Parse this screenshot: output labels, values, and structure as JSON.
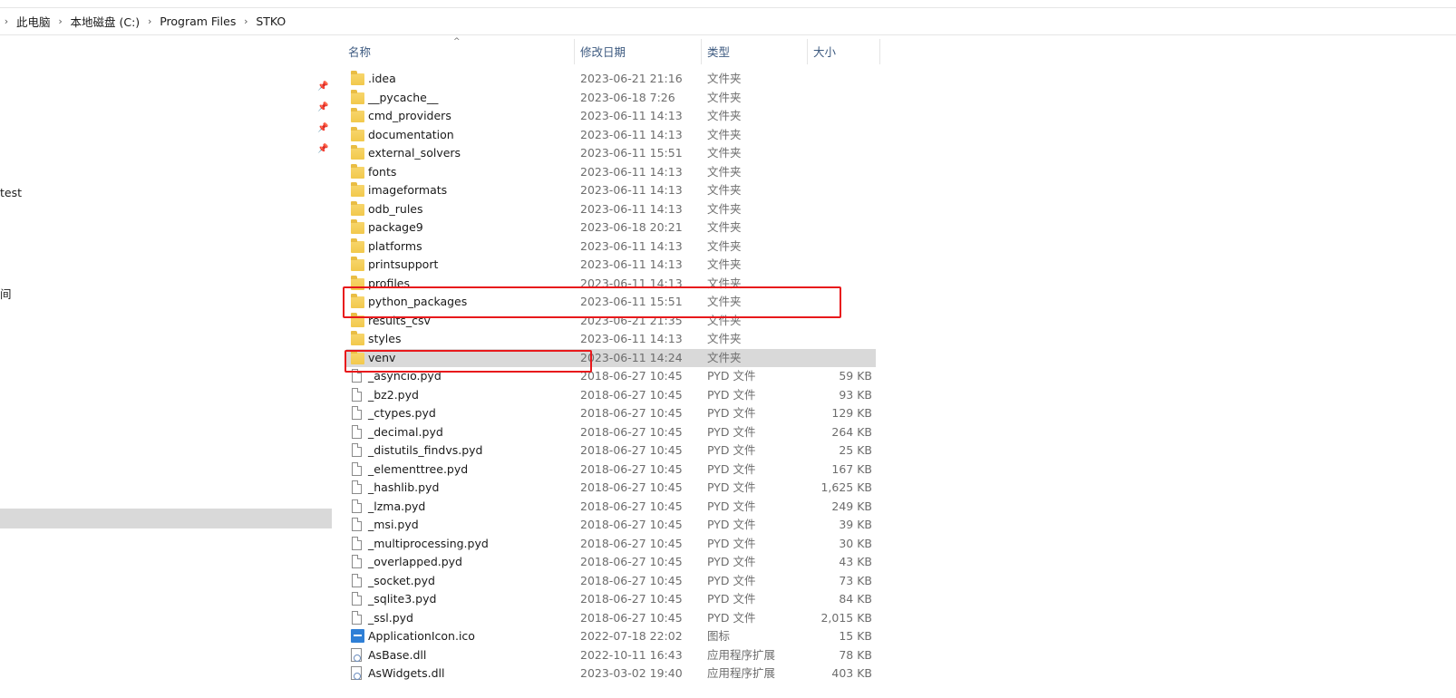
{
  "breadcrumb": [
    "此电脑",
    "本地磁盘 (C:)",
    "Program Files",
    "STKO"
  ],
  "nav": {
    "items": [
      "test",
      "间"
    ]
  },
  "columns": {
    "name": "名称",
    "date": "修改日期",
    "type": "类型",
    "size": "大小"
  },
  "files": [
    {
      "name": ".idea",
      "date": "2023-06-21 21:16",
      "type": "文件夹",
      "size": "",
      "icon": "folder-icon"
    },
    {
      "name": "__pycache__",
      "date": "2023-06-18 7:26",
      "type": "文件夹",
      "size": "",
      "icon": "folder-icon"
    },
    {
      "name": "cmd_providers",
      "date": "2023-06-11 14:13",
      "type": "文件夹",
      "size": "",
      "icon": "folder-icon"
    },
    {
      "name": "documentation",
      "date": "2023-06-11 14:13",
      "type": "文件夹",
      "size": "",
      "icon": "folder-icon"
    },
    {
      "name": "external_solvers",
      "date": "2023-06-11 15:51",
      "type": "文件夹",
      "size": "",
      "icon": "folder-icon"
    },
    {
      "name": "fonts",
      "date": "2023-06-11 14:13",
      "type": "文件夹",
      "size": "",
      "icon": "folder-icon"
    },
    {
      "name": "imageformats",
      "date": "2023-06-11 14:13",
      "type": "文件夹",
      "size": "",
      "icon": "folder-icon"
    },
    {
      "name": "odb_rules",
      "date": "2023-06-11 14:13",
      "type": "文件夹",
      "size": "",
      "icon": "folder-icon"
    },
    {
      "name": "package9",
      "date": "2023-06-18 20:21",
      "type": "文件夹",
      "size": "",
      "icon": "folder-icon"
    },
    {
      "name": "platforms",
      "date": "2023-06-11 14:13",
      "type": "文件夹",
      "size": "",
      "icon": "folder-icon"
    },
    {
      "name": "printsupport",
      "date": "2023-06-11 14:13",
      "type": "文件夹",
      "size": "",
      "icon": "folder-icon"
    },
    {
      "name": "profiles",
      "date": "2023-06-11 14:13",
      "type": "文件夹",
      "size": "",
      "icon": "folder-icon"
    },
    {
      "name": "python_packages",
      "date": "2023-06-11 15:51",
      "type": "文件夹",
      "size": "",
      "icon": "folder-icon"
    },
    {
      "name": "results_csv",
      "date": "2023-06-21 21:35",
      "type": "文件夹",
      "size": "",
      "icon": "folder-icon"
    },
    {
      "name": "styles",
      "date": "2023-06-11 14:13",
      "type": "文件夹",
      "size": "",
      "icon": "folder-icon"
    },
    {
      "name": "venv",
      "date": "2023-06-11 14:24",
      "type": "文件夹",
      "size": "",
      "icon": "folder-icon",
      "selected": true
    },
    {
      "name": "_asyncio.pyd",
      "date": "2018-06-27 10:45",
      "type": "PYD 文件",
      "size": "59 KB",
      "icon": "file-icon"
    },
    {
      "name": "_bz2.pyd",
      "date": "2018-06-27 10:45",
      "type": "PYD 文件",
      "size": "93 KB",
      "icon": "file-icon"
    },
    {
      "name": "_ctypes.pyd",
      "date": "2018-06-27 10:45",
      "type": "PYD 文件",
      "size": "129 KB",
      "icon": "file-icon"
    },
    {
      "name": "_decimal.pyd",
      "date": "2018-06-27 10:45",
      "type": "PYD 文件",
      "size": "264 KB",
      "icon": "file-icon"
    },
    {
      "name": "_distutils_findvs.pyd",
      "date": "2018-06-27 10:45",
      "type": "PYD 文件",
      "size": "25 KB",
      "icon": "file-icon"
    },
    {
      "name": "_elementtree.pyd",
      "date": "2018-06-27 10:45",
      "type": "PYD 文件",
      "size": "167 KB",
      "icon": "file-icon"
    },
    {
      "name": "_hashlib.pyd",
      "date": "2018-06-27 10:45",
      "type": "PYD 文件",
      "size": "1,625 KB",
      "icon": "file-icon"
    },
    {
      "name": "_lzma.pyd",
      "date": "2018-06-27 10:45",
      "type": "PYD 文件",
      "size": "249 KB",
      "icon": "file-icon"
    },
    {
      "name": "_msi.pyd",
      "date": "2018-06-27 10:45",
      "type": "PYD 文件",
      "size": "39 KB",
      "icon": "file-icon"
    },
    {
      "name": "_multiprocessing.pyd",
      "date": "2018-06-27 10:45",
      "type": "PYD 文件",
      "size": "30 KB",
      "icon": "file-icon"
    },
    {
      "name": "_overlapped.pyd",
      "date": "2018-06-27 10:45",
      "type": "PYD 文件",
      "size": "43 KB",
      "icon": "file-icon"
    },
    {
      "name": "_socket.pyd",
      "date": "2018-06-27 10:45",
      "type": "PYD 文件",
      "size": "73 KB",
      "icon": "file-icon"
    },
    {
      "name": "_sqlite3.pyd",
      "date": "2018-06-27 10:45",
      "type": "PYD 文件",
      "size": "84 KB",
      "icon": "file-icon"
    },
    {
      "name": "_ssl.pyd",
      "date": "2018-06-27 10:45",
      "type": "PYD 文件",
      "size": "2,015 KB",
      "icon": "file-icon"
    },
    {
      "name": "ApplicationIcon.ico",
      "date": "2022-07-18 22:02",
      "type": "图标",
      "size": "15 KB",
      "icon": "app-icon"
    },
    {
      "name": "AsBase.dll",
      "date": "2022-10-11 16:43",
      "type": "应用程序扩展",
      "size": "78 KB",
      "icon": "dll-icon"
    },
    {
      "name": "AsWidgets.dll",
      "date": "2023-03-02 19:40",
      "type": "应用程序扩展",
      "size": "403 KB",
      "icon": "dll-icon"
    }
  ],
  "annotations": {
    "color": "#e8191c"
  }
}
